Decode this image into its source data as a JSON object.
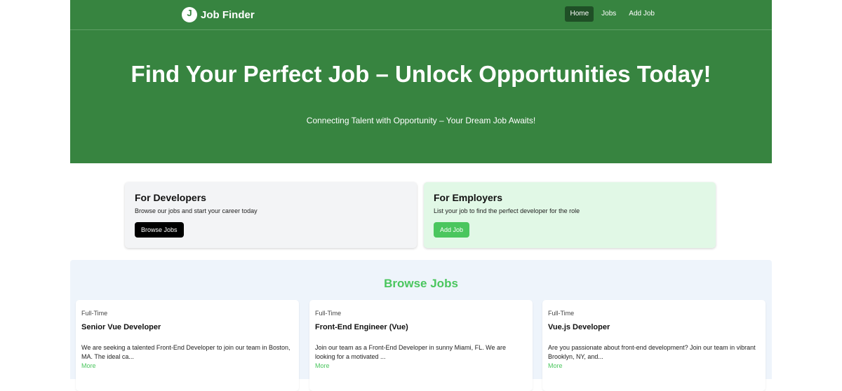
{
  "nav": {
    "logo_letter": "J",
    "brand": "Job Finder",
    "links": [
      {
        "label": "Home",
        "active": true
      },
      {
        "label": "Jobs",
        "active": false
      },
      {
        "label": "Add Job",
        "active": false
      }
    ]
  },
  "hero": {
    "title": "Find Your Perfect Job – Unlock Opportunities Today!",
    "subtitle": "Connecting Talent with Opportunity – Your Dream Job Awaits!"
  },
  "cards": {
    "developers": {
      "title": "For Developers",
      "text": "Browse our jobs and start your career today",
      "button": "Browse Jobs"
    },
    "employers": {
      "title": "For Employers",
      "text": "List your job to find the perfect developer for the role",
      "button": "Add Job"
    }
  },
  "jobs": {
    "heading": "Browse Jobs",
    "items": [
      {
        "type": "Full-Time",
        "title": "Senior Vue Developer",
        "description": "We are seeking a talented Front-End Developer to join our team in Boston, MA. The ideal ca...",
        "more": "More"
      },
      {
        "type": "Full-Time",
        "title": "Front-End Engineer (Vue)",
        "description": "Join our team as a Front-End Developer in sunny Miami, FL. We are looking for a motivated ...",
        "more": "More"
      },
      {
        "type": "Full-Time",
        "title": "Vue.js Developer",
        "description": "Are you passionate about front-end development? Join our team in vibrant Brooklyn, NY, and...",
        "more": "More"
      }
    ]
  },
  "colors": {
    "brand_green": "#378440",
    "accent_green": "#4ac65e",
    "active_nav": "#1f4f26"
  }
}
